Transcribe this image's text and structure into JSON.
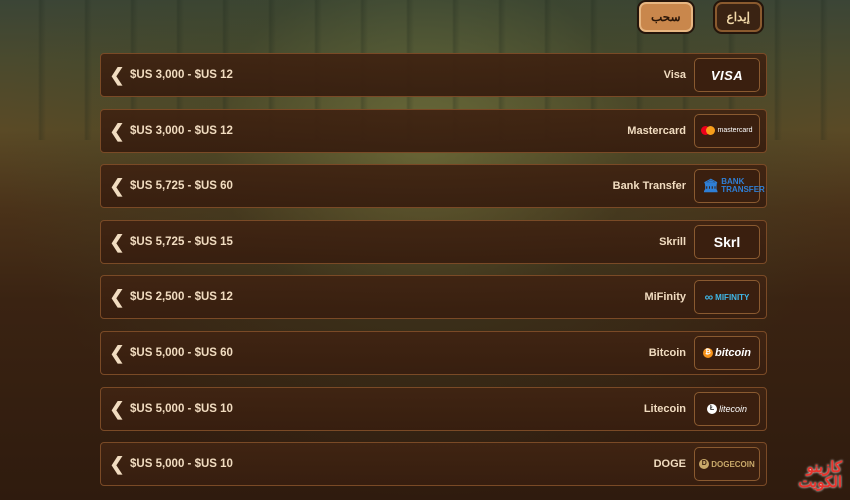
{
  "tabs": {
    "withdraw": "سحب",
    "deposit": "إيداع"
  },
  "methods": [
    {
      "limits": "$US 3,000 - $US 12",
      "name": "Visa",
      "logo": "VISA"
    },
    {
      "limits": "$US 3,000 - $US 12",
      "name": "Mastercard",
      "logo": "mastercard"
    },
    {
      "limits": "$US 5,725 - $US 60",
      "name": "Bank Transfer",
      "logo": "BANK TRANSFER"
    },
    {
      "limits": "$US 5,725 - $US 15",
      "name": "Skrill",
      "logo": "Skrl"
    },
    {
      "limits": "$US 2,500 - $US 12",
      "name": "MiFinity",
      "logo": "MIFINITY"
    },
    {
      "limits": "$US 5,000 - $US 60",
      "name": "Bitcoin",
      "logo": "bitcoin"
    },
    {
      "limits": "$US 5,000 - $US 10",
      "name": "Litecoin",
      "logo": "litecoin"
    },
    {
      "limits": "$US 5,000 - $US 10",
      "name": "DOGE",
      "logo": "DOGECOIN"
    }
  ],
  "brand": {
    "line1": "كازينو",
    "line2": "الكويت"
  }
}
